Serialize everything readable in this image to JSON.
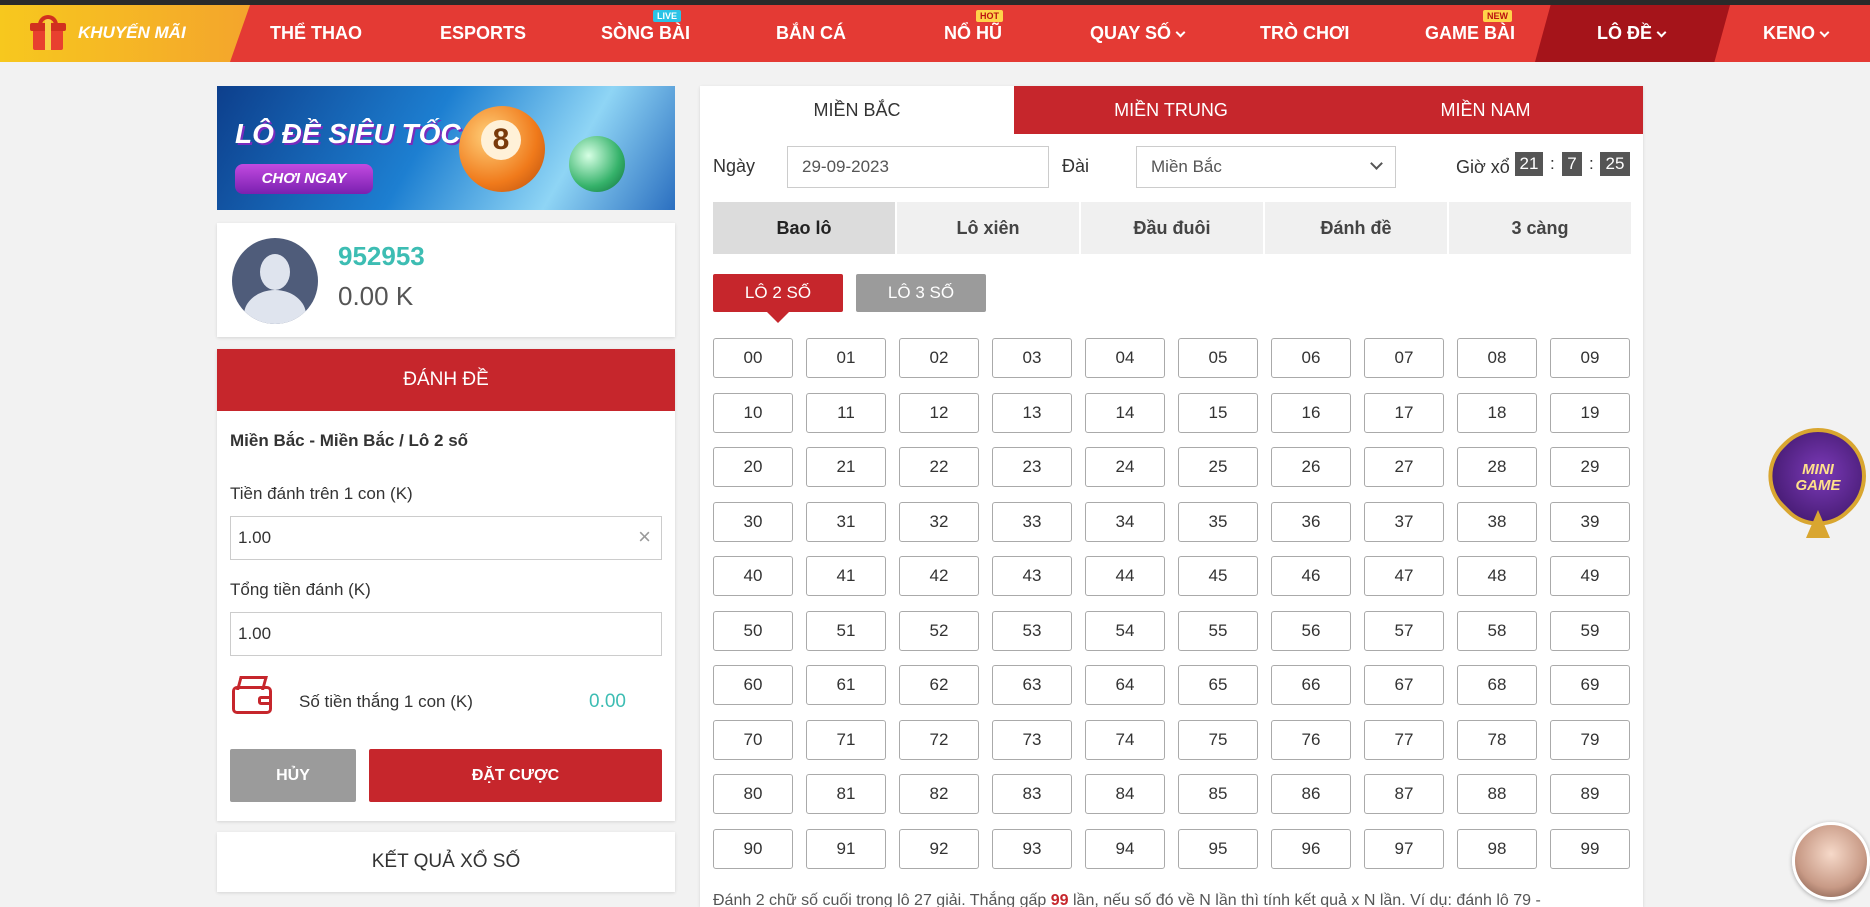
{
  "nav": {
    "promo": "KHUYẾN MÃI",
    "items": [
      {
        "label": "THỂ THAO",
        "badge": ""
      },
      {
        "label": "ESPORTS",
        "badge": ""
      },
      {
        "label": "SÒNG BÀI",
        "badge": "LIVE"
      },
      {
        "label": "BẮN CÁ",
        "badge": ""
      },
      {
        "label": "NỔ HŨ",
        "badge": "HOT"
      },
      {
        "label": "QUAY SỐ",
        "badge": ""
      },
      {
        "label": "TRÒ CHƠI",
        "badge": ""
      },
      {
        "label": "GAME BÀI",
        "badge": "NEW"
      },
      {
        "label": "LÔ ĐỀ",
        "badge": ""
      },
      {
        "label": "KENO",
        "badge": ""
      }
    ]
  },
  "banner": {
    "title": "LÔ ĐỀ SIÊU TỐC",
    "button": "CHƠI NGAY",
    "ball_number": "8"
  },
  "user": {
    "name": "952953",
    "balance": "0.00 K"
  },
  "bet": {
    "header": "ĐÁNH ĐỀ",
    "subtitle": "Miền Bắc - Miền Bắc / Lô 2 số",
    "stake_label": "Tiền đánh trên 1 con (K)",
    "stake_value": "1.00",
    "total_label": "Tổng tiền đánh (K)",
    "total_value": "1.00",
    "win_label": "Số tiền thắng 1 con (K)",
    "win_value": "0.00",
    "cancel": "HỦY",
    "place": "ĐẶT CƯỢC"
  },
  "results": {
    "label": "KẾT QUẢ XỔ SỐ"
  },
  "regions": [
    "MIỀN BẮC",
    "MIỀN TRUNG",
    "MIỀN NAM"
  ],
  "filters": {
    "date_label": "Ngày",
    "date_value": "29-09-2023",
    "station_label": "Đài",
    "station_value": "Miền Bắc",
    "timer_label": "Giờ xổ",
    "hh": "21",
    "mm": "7",
    "ss": "25",
    "sep": ":"
  },
  "game_tabs": [
    "Bao lô",
    "Lô xiên",
    "Đầu đuôi",
    "Đánh đề",
    "3 càng"
  ],
  "sub_tabs": [
    "LÔ 2 SỐ",
    "LÔ 3 SỐ"
  ],
  "numbers": [
    "00",
    "01",
    "02",
    "03",
    "04",
    "05",
    "06",
    "07",
    "08",
    "09",
    "10",
    "11",
    "12",
    "13",
    "14",
    "15",
    "16",
    "17",
    "18",
    "19",
    "20",
    "21",
    "22",
    "23",
    "24",
    "25",
    "26",
    "27",
    "28",
    "29",
    "30",
    "31",
    "32",
    "33",
    "34",
    "35",
    "36",
    "37",
    "38",
    "39",
    "40",
    "41",
    "42",
    "43",
    "44",
    "45",
    "46",
    "47",
    "48",
    "49",
    "50",
    "51",
    "52",
    "53",
    "54",
    "55",
    "56",
    "57",
    "58",
    "59",
    "60",
    "61",
    "62",
    "63",
    "64",
    "65",
    "66",
    "67",
    "68",
    "69",
    "70",
    "71",
    "72",
    "73",
    "74",
    "75",
    "76",
    "77",
    "78",
    "79",
    "80",
    "81",
    "82",
    "83",
    "84",
    "85",
    "86",
    "87",
    "88",
    "89",
    "90",
    "91",
    "92",
    "93",
    "94",
    "95",
    "96",
    "97",
    "98",
    "99"
  ],
  "description": {
    "before": "Đánh 2 chữ số cuối trong lô 27 giải. Thắng gấp ",
    "highlight": "99",
    "after": " lần, nếu số đó về N lần thì tính kết quả x N lần. Ví dụ: đánh lô 79 -"
  },
  "minigame": {
    "line1": "MINI",
    "line2": "GAME"
  },
  "colors": {
    "primary_red": "#c6262c",
    "nav_red": "#e43a34",
    "teal": "#3dbdb3",
    "gray_button": "#9b9b9b"
  }
}
